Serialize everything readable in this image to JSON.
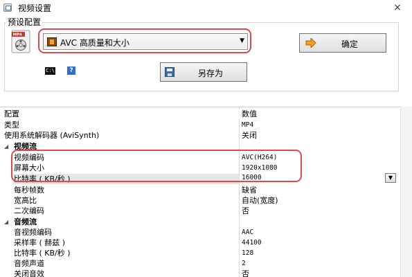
{
  "window": {
    "title": "视频设置",
    "close_glyph": "×"
  },
  "preset": {
    "group_label": "预设配置",
    "format_icon_text": "MP4",
    "selected_value": "AVC 高质量和大小",
    "ok_label": "确定",
    "save_as_label": "另存为",
    "cmd_icon_text": "C:\\",
    "help_icon_text": "?"
  },
  "grid": {
    "col_property": "配置",
    "col_value": "数值",
    "rows": [
      {
        "key": "类型",
        "value": "MP4"
      },
      {
        "key": "使用系统解码器 (AviSynth)",
        "value": "关闭"
      },
      {
        "key": "视频流",
        "section": true
      },
      {
        "key": "视频编码",
        "value": "AVC(H264)"
      },
      {
        "key": "屏幕大小",
        "value": "1920x1080"
      },
      {
        "key": "比特率 ( KB/秒 )",
        "value": "16000",
        "editing": true
      },
      {
        "key": "每秒帧数",
        "value": "缺省"
      },
      {
        "key": "宽高比",
        "value": "自动(宽度)"
      },
      {
        "key": "二次编码",
        "value": "否"
      },
      {
        "key": "音频流",
        "section": true
      },
      {
        "key": "音视频编码",
        "value": "AAC"
      },
      {
        "key": "采样率 ( 赫兹 )",
        "value": "44100"
      },
      {
        "key": "比特率 ( KB/秒 )",
        "value": "128"
      },
      {
        "key": "音频声道",
        "value": "2"
      },
      {
        "key": "关闭音效",
        "value": "否"
      }
    ]
  },
  "colors": {
    "highlight": "#e0484f",
    "selected_row": "#e6e6e6"
  }
}
